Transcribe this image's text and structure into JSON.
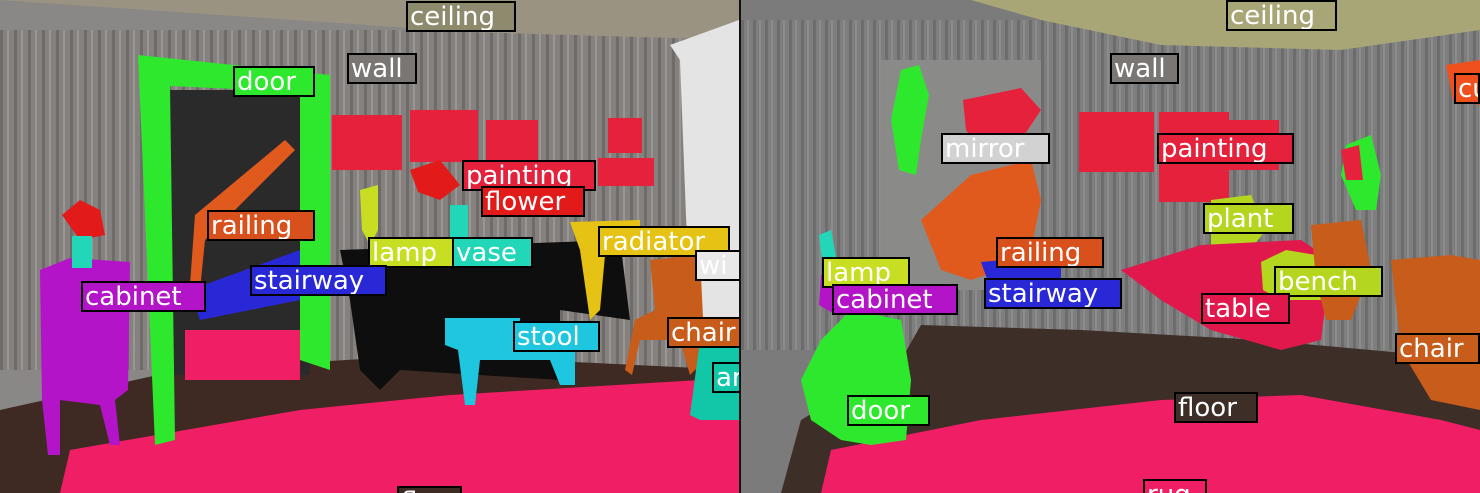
{
  "colors": {
    "ceiling": "#8e8a6e",
    "wall": "#7a7674",
    "door": "#2ee82e",
    "painting": "#e6213c",
    "flower": "#e31a1a",
    "railing": "#d8501c",
    "stairway": "#2828d6",
    "lamp": "#c8de22",
    "vase": "#22d6b8",
    "radiator": "#e6c214",
    "cabinet": "#b414c8",
    "stool": "#1ec6e0",
    "chair": "#c85c1a",
    "armchair": "#12c6a8",
    "window": "#e8e8e8",
    "rug": "#f01e64",
    "floor": "#3e2a22",
    "mirror": "#d2d2d2",
    "plant": "#b4d61e",
    "bench": "#b4d61e",
    "table": "#e0184c",
    "curtain": "#f0501e"
  },
  "left_panel": {
    "labels": [
      {
        "key": "ceiling",
        "text": "ceiling"
      },
      {
        "key": "door",
        "text": "door"
      },
      {
        "key": "wall",
        "text": "wall"
      },
      {
        "key": "painting",
        "text": "painting"
      },
      {
        "key": "flower",
        "text": "flower"
      },
      {
        "key": "railing",
        "text": "railing"
      },
      {
        "key": "radiator",
        "text": "radiator"
      },
      {
        "key": "lamp",
        "text": "lamp"
      },
      {
        "key": "vase",
        "text": "vase"
      },
      {
        "key": "window",
        "text": "wi"
      },
      {
        "key": "stairway",
        "text": "stairway"
      },
      {
        "key": "cabinet",
        "text": "cabinet"
      },
      {
        "key": "stool",
        "text": "stool"
      },
      {
        "key": "chair",
        "text": "chair"
      },
      {
        "key": "armchair",
        "text": "ar"
      },
      {
        "key": "floor",
        "text": "floor"
      }
    ]
  },
  "right_panel": {
    "labels": [
      {
        "key": "ceiling",
        "text": "ceiling"
      },
      {
        "key": "wall",
        "text": "wall"
      },
      {
        "key": "curtain",
        "text": "cu"
      },
      {
        "key": "mirror",
        "text": "mirror"
      },
      {
        "key": "painting",
        "text": "painting"
      },
      {
        "key": "plant",
        "text": "plant"
      },
      {
        "key": "railing",
        "text": "railing"
      },
      {
        "key": "lamp",
        "text": "lamp"
      },
      {
        "key": "bench",
        "text": "bench"
      },
      {
        "key": "cabinet",
        "text": "cabinet"
      },
      {
        "key": "stairway",
        "text": "stairway"
      },
      {
        "key": "table",
        "text": "table"
      },
      {
        "key": "chair",
        "text": "chair"
      },
      {
        "key": "door",
        "text": "door"
      },
      {
        "key": "floor",
        "text": "floor"
      },
      {
        "key": "rug",
        "text": "rug"
      }
    ]
  }
}
